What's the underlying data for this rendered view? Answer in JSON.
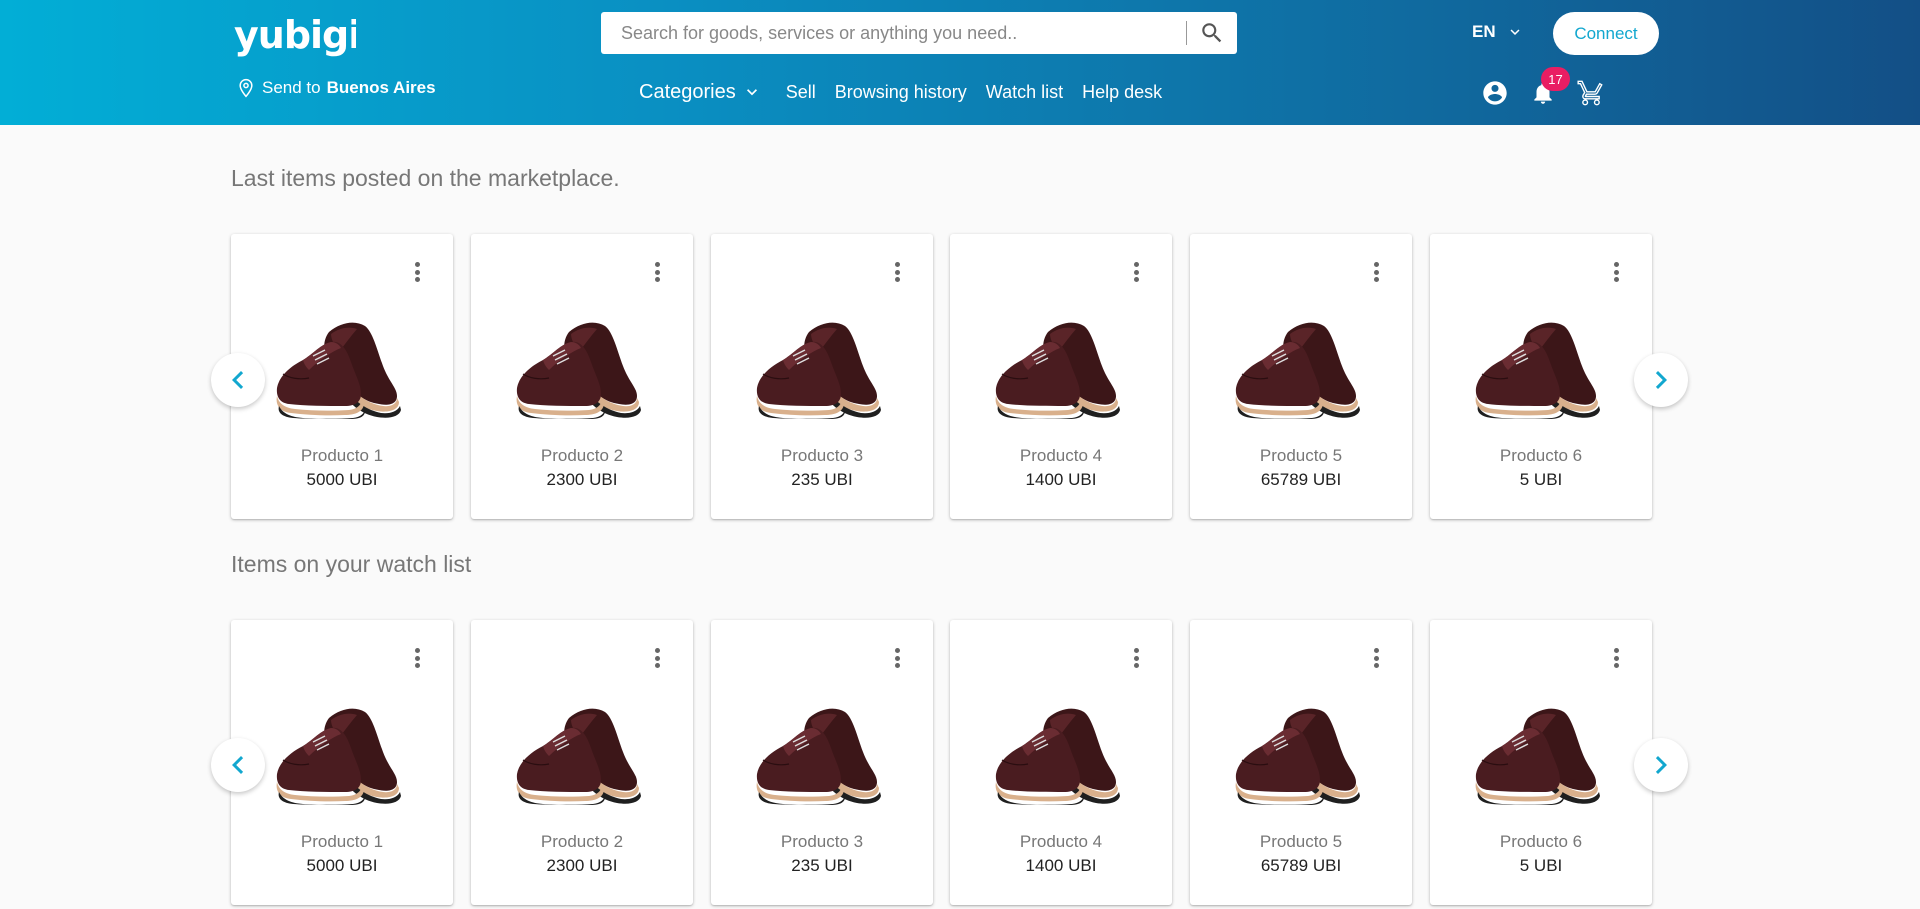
{
  "colors": {
    "header_start": "#02aed6",
    "header_end": "#134f86",
    "accent": "#12a7cf",
    "badge": "#e91e63"
  },
  "header": {
    "logo_text": "yubigi",
    "send_to_prefix": "Send to",
    "send_to_city": "Buenos Aires",
    "search_placeholder": "Search for goods, services or anything you need..",
    "language": "EN",
    "connect_label": "Connect",
    "notification_count": "17",
    "icons": [
      "location-pin-icon",
      "search-icon",
      "chevron-down-icon",
      "account-circle-icon",
      "bell-icon",
      "cart-icon"
    ]
  },
  "nav": {
    "categories": "Categories",
    "sell": "Sell",
    "browsing_history": "Browsing history",
    "watch_list": "Watch list",
    "help_desk": "Help desk"
  },
  "sections": [
    {
      "title": "Last items posted on the marketplace.",
      "items": [
        {
          "name": "Producto 1",
          "price": "5000 UBI"
        },
        {
          "name": "Producto 2",
          "price": "2300 UBI"
        },
        {
          "name": "Producto 3",
          "price": "235 UBI"
        },
        {
          "name": "Producto 4",
          "price": "1400 UBI"
        },
        {
          "name": "Producto 5",
          "price": "65789 UBI"
        },
        {
          "name": "Producto 6",
          "price": "5 UBI"
        }
      ]
    },
    {
      "title": "Items on your watch list",
      "items": [
        {
          "name": "Producto 1",
          "price": "5000 UBI"
        },
        {
          "name": "Producto 2",
          "price": "2300 UBI"
        },
        {
          "name": "Producto 3",
          "price": "235 UBI"
        },
        {
          "name": "Producto 4",
          "price": "1400 UBI"
        },
        {
          "name": "Producto 5",
          "price": "65789 UBI"
        },
        {
          "name": "Producto 6",
          "price": "5 UBI"
        }
      ]
    }
  ]
}
